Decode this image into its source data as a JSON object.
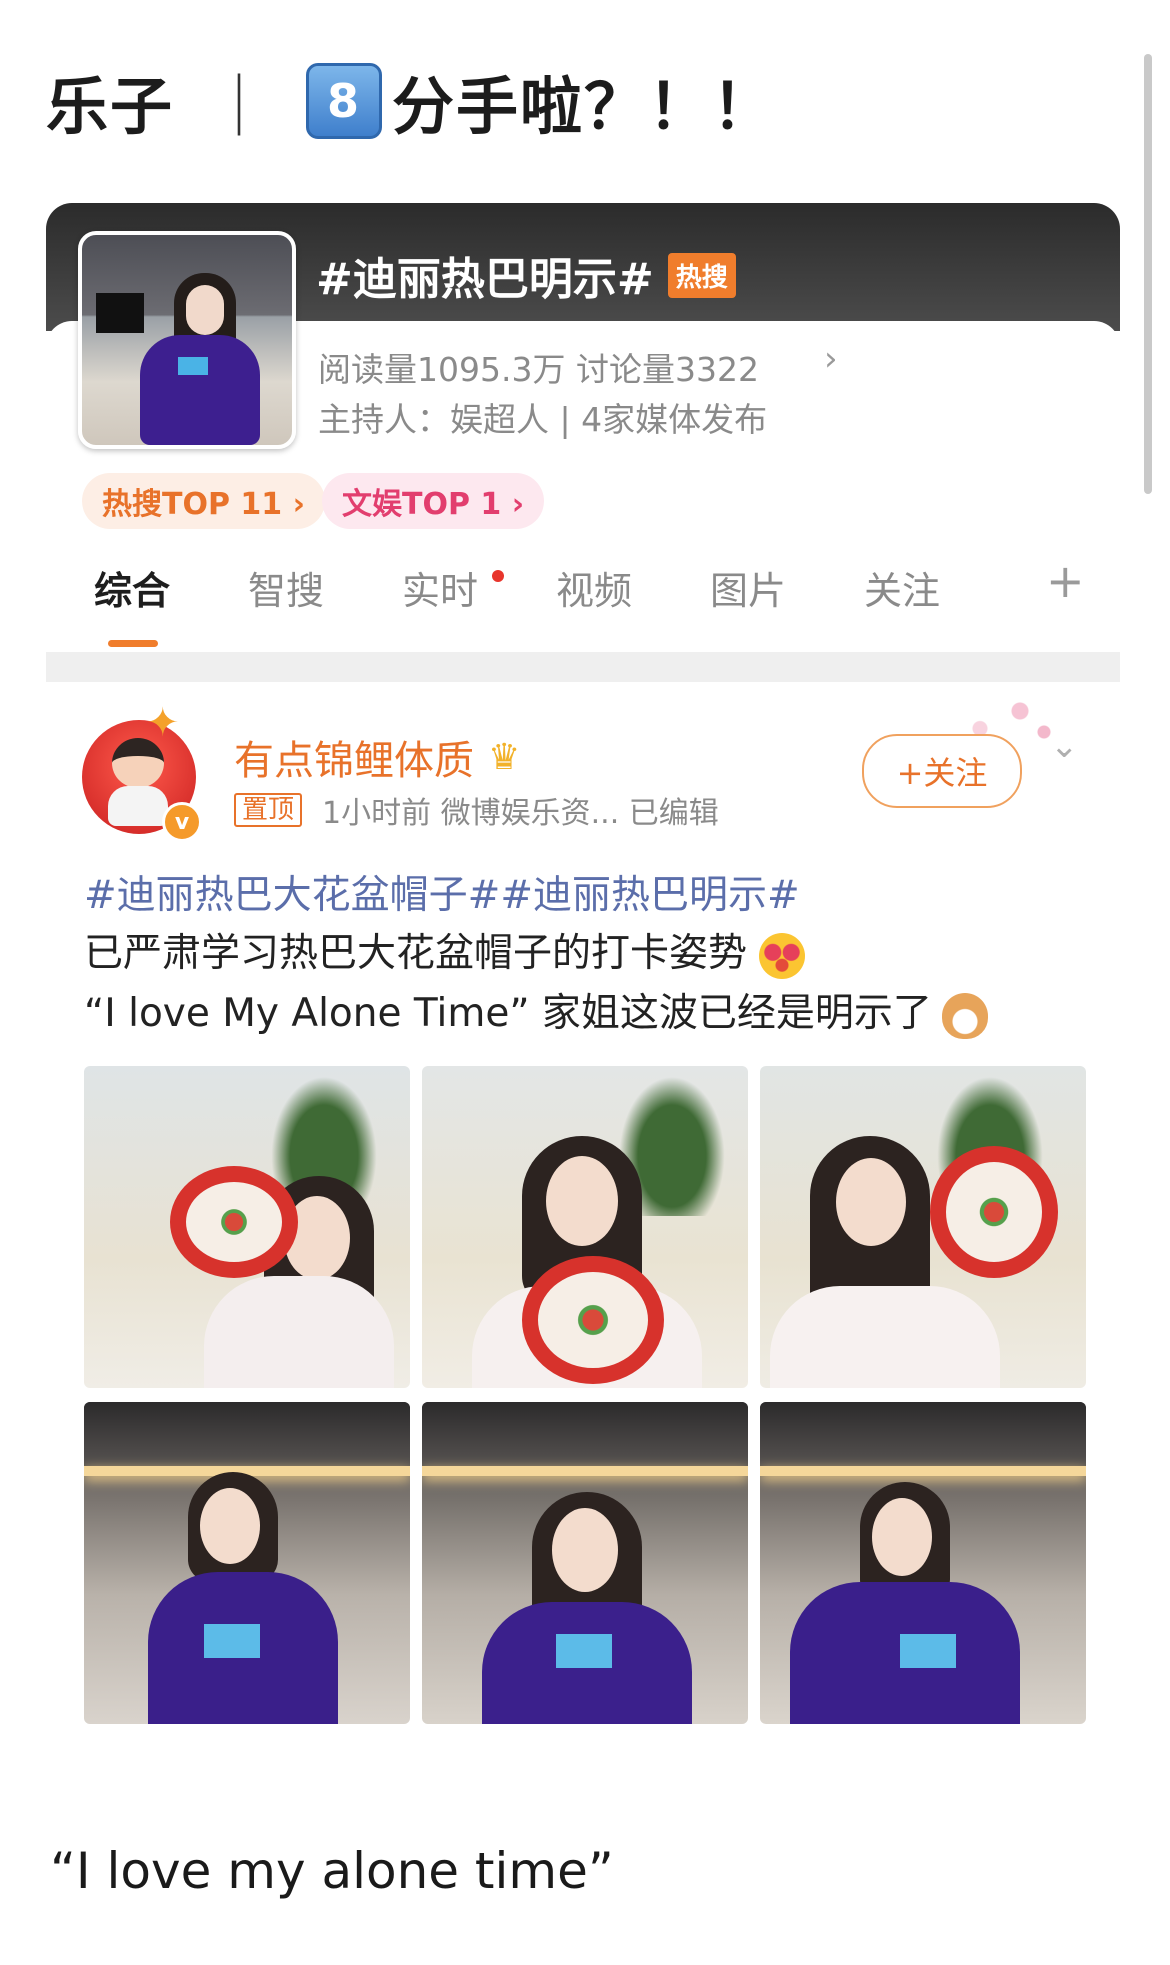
{
  "page": {
    "title_prefix": "乐子",
    "title_separator": "｜",
    "title_number_emoji": "8",
    "title_suffix": "分手啦？！！"
  },
  "topic": {
    "title": "#迪丽热巴明示#",
    "hot_badge": "热搜",
    "stats": "阅读量1095.3万  讨论量3322",
    "host": "主持人：娱超人 | 4家媒体发布",
    "chevron": "›",
    "tags": [
      "热搜TOP 11 ›",
      "文娱TOP 1 ›"
    ]
  },
  "tabs": {
    "items": [
      "综合",
      "智搜",
      "实时",
      "视频",
      "图片",
      "关注"
    ],
    "active_index": 0,
    "plus": "+"
  },
  "post": {
    "username": "有点锦鲤体质",
    "crown_icon": "crown-icon",
    "verify_mark": "v",
    "pin_label": "置顶",
    "meta": "1小时前   微博娱乐资...   已编辑",
    "follow_label": "+关注",
    "more_icon": "chevron-down-icon",
    "hashtags": "#迪丽热巴大花盆帽子##迪丽热巴明示#",
    "line1": "已严肃学习热巴大花盆帽子的打卡姿势",
    "line2": "“I love My Alone Time” 家姐这波已经是明示了",
    "photo_count": 6
  },
  "caption": "“I love my alone time”",
  "colors": {
    "accent_orange": "#e8722a",
    "topic_link": "#5b6eaa",
    "banner_dark": "#2b2b2b",
    "hot_badge": "#f07d2c",
    "tag_hot_bg": "#fdeee5",
    "tag_ent_text": "#e23e6e"
  }
}
